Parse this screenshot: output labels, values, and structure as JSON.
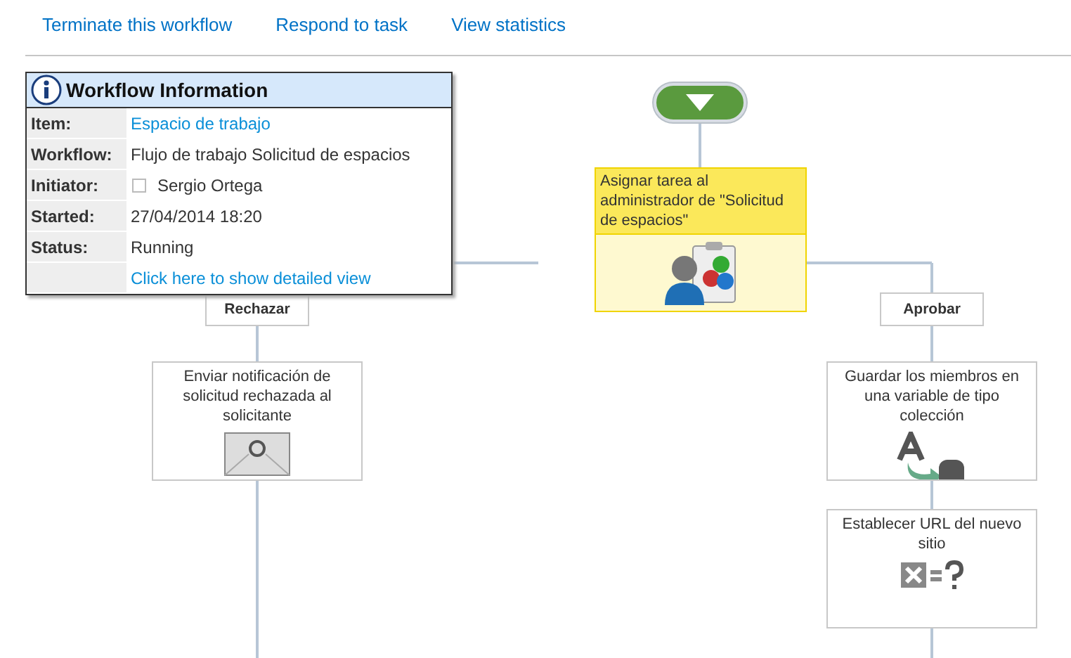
{
  "actions": [
    {
      "label": "Terminate this workflow"
    },
    {
      "label": "Respond to task"
    },
    {
      "label": "View statistics"
    }
  ],
  "info_panel": {
    "title": "Workflow Information",
    "rows": [
      {
        "label": "Item:",
        "value": "Espacio de trabajo",
        "kind": "link"
      },
      {
        "label": "Workflow:",
        "value": "Flujo de trabajo Solicitud de espacios",
        "kind": "text"
      },
      {
        "label": "Initiator:",
        "value": "Sergio Ortega",
        "kind": "user"
      },
      {
        "label": "Started:",
        "value": "27/04/2014 18:20",
        "kind": "text"
      },
      {
        "label": "Status:",
        "value": "Running",
        "kind": "text"
      },
      {
        "label": "",
        "value": "Click here to show detailed view",
        "kind": "link"
      }
    ]
  },
  "workflow": {
    "current_step": {
      "text": "Asignar tarea al administrador de \"Solicitud de espacios\"",
      "highlighted": true
    },
    "branches": [
      {
        "label": "Rechazar",
        "steps": [
          {
            "text": "Enviar notificación de solicitud rechazada al solicitante",
            "kind": "email"
          }
        ]
      },
      {
        "label": "Aprobar",
        "steps": [
          {
            "text": "Guardar los miembros en una variable de tipo colección",
            "kind": "assign"
          },
          {
            "text": "Establecer URL del nuevo sitio",
            "kind": "variable"
          }
        ]
      }
    ]
  }
}
